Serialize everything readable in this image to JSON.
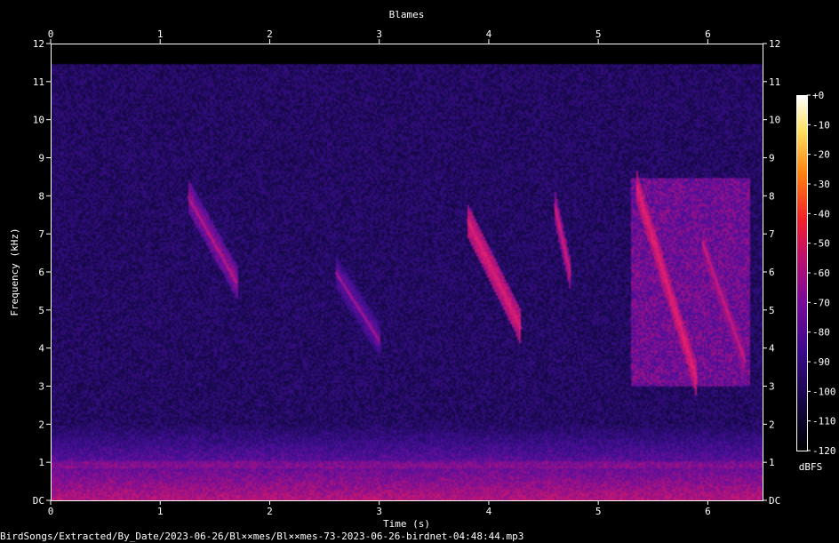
{
  "chart_data": {
    "type": "heatmap",
    "title": "Blames",
    "xlabel": "Time (s)",
    "ylabel": "Frequency (kHz)",
    "xlim": [
      0,
      6.5
    ],
    "ylim": [
      0,
      12
    ],
    "x_ticks": [
      "0",
      "1",
      "2",
      "3",
      "4",
      "5",
      "6"
    ],
    "y_ticks": [
      "DC",
      "1",
      "2",
      "3",
      "4",
      "5",
      "6",
      "7",
      "8",
      "9",
      "10",
      "11",
      "12"
    ],
    "colorbar": {
      "label": "dBFS",
      "min": -120,
      "max": 0,
      "ticks": [
        "+0",
        "-10",
        "-20",
        "-30",
        "-40",
        "-50",
        "-60",
        "-70",
        "-80",
        "-90",
        "-100",
        "-110",
        "-120"
      ]
    },
    "grid": false,
    "colors": {
      "background": "#000000",
      "noise_floor": "#2a0d66",
      "low_band": "#b0146e",
      "strong_call": "#e0208a"
    },
    "events": [
      {
        "t0": 1.25,
        "t1": 1.7,
        "f_hi": 8.0,
        "f_lo": 5.7,
        "level": -75
      },
      {
        "t0": 2.6,
        "t1": 3.0,
        "f_hi": 6.0,
        "f_lo": 4.2,
        "level": -82
      },
      {
        "t0": 3.8,
        "t1": 4.3,
        "f_hi": 7.4,
        "f_lo": 4.5,
        "level": -62
      },
      {
        "t0": 4.6,
        "t1": 4.75,
        "f_hi": 7.8,
        "f_lo": 5.9,
        "level": -68
      },
      {
        "t0": 5.35,
        "t1": 5.9,
        "f_hi": 8.3,
        "f_lo": 3.2,
        "level": -60
      },
      {
        "t0": 5.95,
        "t1": 6.35,
        "f_hi": 6.8,
        "f_lo": 3.6,
        "level": -70
      }
    ]
  },
  "footer": {
    "path": "BirdSongs/Extracted/By_Date/2023-06-26/Bl××mes/Bl××mes-73-2023-06-26-birdnet-04:48:44.mp3"
  }
}
